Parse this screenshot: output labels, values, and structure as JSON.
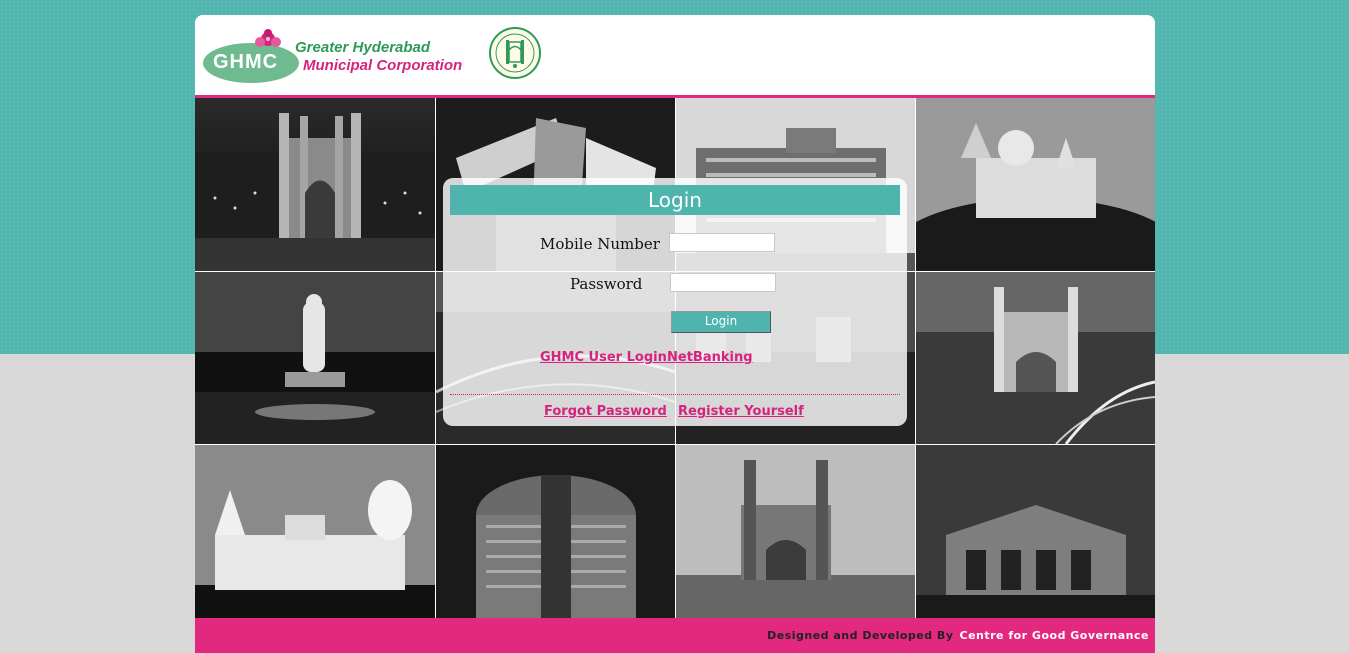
{
  "header": {
    "logo_abbrev": "GHMC",
    "org_name_line1": "Greater Hyderabad",
    "org_name_line2": "Municipal Corporation"
  },
  "login": {
    "title": "Login",
    "mobile_label": "Mobile Number",
    "mobile_value": "",
    "password_label": "Password",
    "password_value": "",
    "submit_label": "Login",
    "links": {
      "user_login": "GHMC User Login",
      "netbanking": "NetBanking",
      "forgot_password": "Forgot Password",
      "register": "Register Yourself"
    }
  },
  "footer": {
    "designed_by": "Designed and Developed By",
    "developer": "Centre for Good Governance"
  },
  "colors": {
    "teal": "#4fb3ae",
    "pink": "#e2287f",
    "link_pink": "#d6237e",
    "green": "#2e9a58"
  }
}
